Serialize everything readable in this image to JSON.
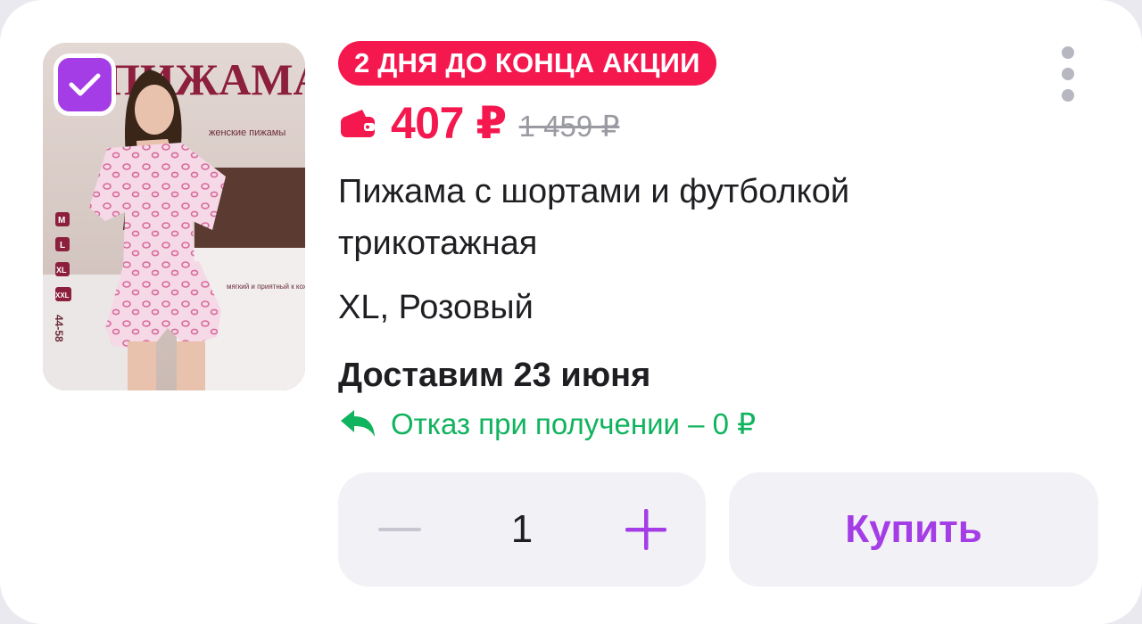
{
  "product": {
    "image_alt": "Пижама",
    "image_text": {
      "brand": "ПИЖАМА",
      "tagline": "женские пижамы",
      "sizes": [
        "M",
        "L",
        "XL",
        "XXL"
      ],
      "size_range": "44-58",
      "feature": "мягкий и приятный к коже"
    },
    "selected": true,
    "promo_badge": "2 ДНЯ ДО КОНЦА АКЦИИ",
    "price": "407 ₽",
    "old_price": "1 459 ₽",
    "title": "Пижама с шортами и футболкой трикотажная",
    "variant": "XL, Розовый",
    "delivery": "Доставим 23 июня",
    "returns": "Отказ при получении – 0 ₽",
    "quantity": "1",
    "buy_label": "Купить"
  },
  "colors": {
    "accent": "#a43de6",
    "price_red": "#f4184f",
    "green": "#10b35e",
    "muted": "#9a9aa2"
  },
  "icons": [
    "checkbox-checked-icon",
    "wallet-icon",
    "return-arrow-icon",
    "more-vertical-icon",
    "minus-icon",
    "plus-icon"
  ]
}
